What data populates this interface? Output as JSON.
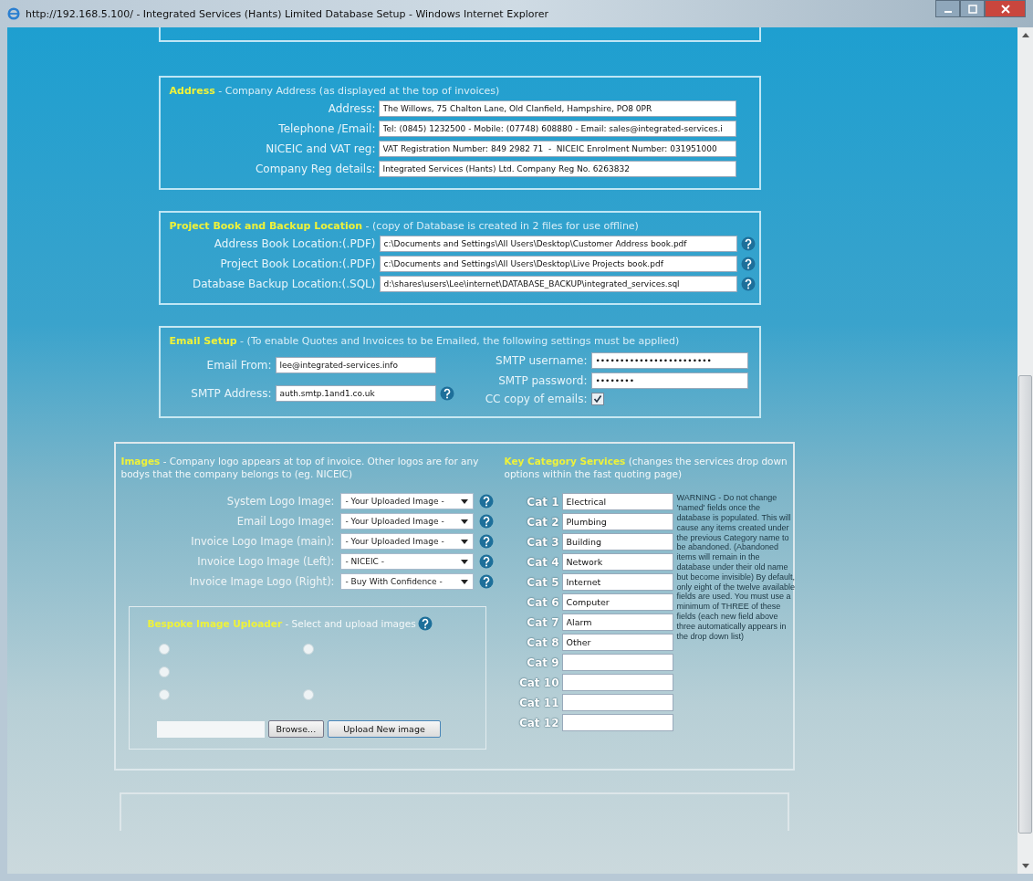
{
  "window": {
    "title": "http://192.168.5.100/ - Integrated Services (Hants) Limited Database Setup - Windows Internet Explorer"
  },
  "address": {
    "heading": "Address",
    "subtitle": " - Company Address (as displayed at the top of invoices)",
    "fields": [
      {
        "label": "Address:",
        "value": "The Willows, 75 Chalton Lane, Old Clanfield, Hampshire, PO8 0PR"
      },
      {
        "label": "Telephone /Email:",
        "value": "Tel: (0845) 1232500 - Mobile: (07748) 608880 - Email: sales@integrated-services.i"
      },
      {
        "label": "NICEIC and VAT reg:",
        "value": "VAT Registration Number: 849 2982 71  -  NICEIC Enrolment Number: 031951000"
      },
      {
        "label": "Company Reg details:",
        "value": "Integrated Services (Hants) Ltd. Company Reg No. 6263832"
      }
    ]
  },
  "backup": {
    "heading": "Project Book and Backup Location",
    "subtitle": " - (copy of Database is created in 2 files for use offline)",
    "fields": [
      {
        "label": "Address Book Location:(.PDF)",
        "value": "c:\\Documents and Settings\\All Users\\Desktop\\Customer Address book.pdf"
      },
      {
        "label": "Project Book Location:(.PDF)",
        "value": "c:\\Documents and Settings\\All Users\\Desktop\\Live Projects book.pdf"
      },
      {
        "label": "Database Backup Location:(.SQL)",
        "value": "d:\\shares\\users\\Lee\\internet\\DATABASE_BACKUP\\integrated_services.sql"
      }
    ]
  },
  "email": {
    "heading": "Email Setup",
    "subtitle": " - (To enable Quotes and Invoices to be Emailed, the following settings must be applied)",
    "from": {
      "label": "Email From:",
      "value": "lee@integrated-services.info"
    },
    "smtp_address": {
      "label": "SMTP Address:",
      "value": "auth.smtp.1and1.co.uk"
    },
    "smtp_username": {
      "label": "SMTP username:",
      "value": "••••••••••••••••••••••••"
    },
    "smtp_password": {
      "label": "SMTP password:",
      "value": "••••••••"
    },
    "cc_copy": {
      "label": "CC copy of emails:",
      "checked": true
    }
  },
  "images": {
    "heading": "Images",
    "subtitle": " - Company logo appears at top of invoice. Other logos are for any bodys that the company belongs to (eg. NICEIC)",
    "selects": [
      {
        "label": "System Logo Image:",
        "value": "- Your Uploaded Image -"
      },
      {
        "label": "Email Logo Image:",
        "value": "- Your Uploaded Image -"
      },
      {
        "label": "Invoice Logo Image (main):",
        "value": "- Your Uploaded Image -"
      },
      {
        "label": "Invoice Logo Image (Left):",
        "value": "- NICEIC -"
      },
      {
        "label": "Invoice Image Logo (Right):",
        "value": "- Buy With Confidence -"
      }
    ],
    "uploader": {
      "heading": "Bespoke Image Uploader",
      "subtitle": " - Select and upload images",
      "radios": [
        {
          "selected": false
        },
        {
          "selected": false
        },
        {
          "selected": false
        },
        {
          "selected": false
        },
        {
          "selected": false
        }
      ],
      "browse": "Browse...",
      "upload": "Upload New image"
    }
  },
  "categories": {
    "heading": "Key Category Services",
    "subtitle": " (changes the services drop down options within the fast quoting page)",
    "items": [
      {
        "label": "Cat 1",
        "value": "Electrical"
      },
      {
        "label": "Cat 2",
        "value": "Plumbing"
      },
      {
        "label": "Cat 3",
        "value": "Building"
      },
      {
        "label": "Cat 4",
        "value": "Network"
      },
      {
        "label": "Cat 5",
        "value": "Internet"
      },
      {
        "label": "Cat 6",
        "value": "Computer"
      },
      {
        "label": "Cat 7",
        "value": "Alarm"
      },
      {
        "label": "Cat 8",
        "value": "Other"
      },
      {
        "label": "Cat 9",
        "value": ""
      },
      {
        "label": "Cat 10",
        "value": ""
      },
      {
        "label": "Cat 11",
        "value": ""
      },
      {
        "label": "Cat 12",
        "value": ""
      }
    ],
    "warning": "WARNING - Do not change 'named' fields once the database is populated. This will cause any items created under the previous Category name to be abandoned. (Abandoned items will remain in the database under their old name but become invisible) By default, only eight of the twelve available fields are used. You must use a minimum of THREE of these fields (each new field above three automatically appears in the drop down list)"
  }
}
